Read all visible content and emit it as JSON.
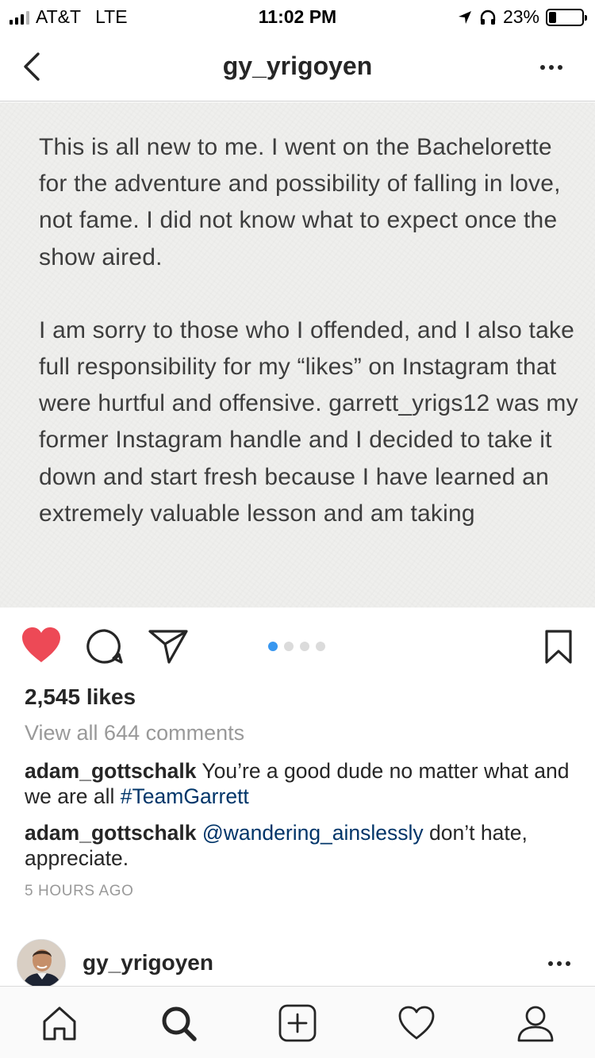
{
  "status_bar": {
    "carrier": "AT&T",
    "network": "LTE",
    "time": "11:02 PM",
    "battery": "23%",
    "battery_level": 0.23
  },
  "header": {
    "title": "gy_yrigoyen",
    "back_icon": "chevron-left-icon",
    "more_icon": "more-horizontal-icon"
  },
  "post": {
    "image_text": [
      "This is all new to me. I went on the Bachelorette for the adventure and possibility of falling in love, not fame.  I did not know what to expect once the show aired.",
      "I am sorry to those who I offended, and I also take full responsibility for my “likes” on Instagram that were hurtful and offensive. garrett_yrigs12 was my former Instagram handle and I decided to take it down and start fresh because I have learned an extremely valuable lesson and am taking"
    ],
    "carousel": {
      "count": 4,
      "active_index": 0
    },
    "likes": "2,545 likes",
    "view_all_comments": "View all 644 comments",
    "comments": [
      {
        "user": "adam_gottschalk",
        "text": "You’re a good dude no matter what and we are all",
        "link": "#TeamGarrett",
        "after": ""
      },
      {
        "user": "adam_gottschalk",
        "text": "",
        "link": "@wandering_ainslessly",
        "after": "don’t hate, appreciate."
      }
    ],
    "timestamp": "5 HOURS AGO"
  },
  "next_post": {
    "username": "gy_yrigoyen"
  },
  "icons": {
    "like": "heart-filled-icon",
    "comment": "comment-icon",
    "share": "paper-plane-icon",
    "save": "bookmark-icon"
  },
  "tabbar": [
    "home-icon",
    "search-icon",
    "add-post-icon",
    "activity-heart-icon",
    "profile-icon"
  ],
  "colors": {
    "like_red": "#ed4956",
    "link_blue": "#003569",
    "carousel_active": "#3897f0",
    "muted": "#999999"
  }
}
